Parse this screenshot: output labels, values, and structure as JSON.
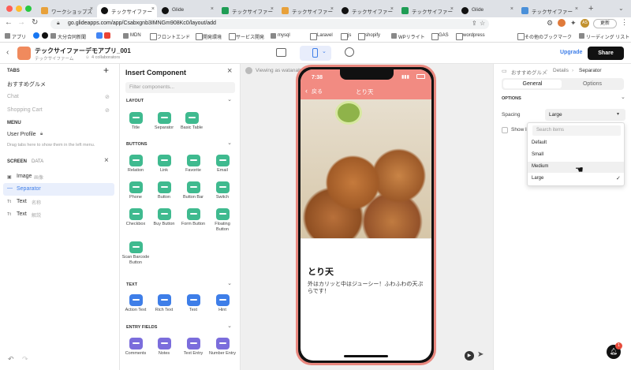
{
  "browser": {
    "tabs": [
      {
        "title": "ワークショップス"
      },
      {
        "title": "テックサイファー"
      },
      {
        "title": "Glide"
      },
      {
        "title": "テックサイファー"
      },
      {
        "title": "テックサイファー"
      },
      {
        "title": "テックサイファー"
      },
      {
        "title": "テックサイファー"
      },
      {
        "title": "Glide"
      },
      {
        "title": "テックサイファー"
      }
    ],
    "url": "go.glideapps.com/app/Csabxgnb3IMNGm908Kc0/layout/add",
    "profile_badge": "AS",
    "update_label": "更新",
    "bookmarks": [
      "アプリ",
      "大分合同新聞",
      "MDN",
      "フロントエンド",
      "開発環境",
      "サービス開発",
      "mysql",
      "Laravel",
      "js",
      "shopify",
      "WPリライト",
      "GAS",
      "wordpress",
      "その他のブックマーク",
      "リーディング リスト"
    ]
  },
  "header": {
    "app_name": "テックサイファーデモアプリ_001",
    "app_sub": "テックサイファーム",
    "collaborators": "4 collaborators",
    "upgrade": "Upgrade",
    "share": "Share"
  },
  "left": {
    "tabs_label": "TABS",
    "tabs": [
      "おすすめグルメ",
      "Chat",
      "Shopping Cart"
    ],
    "menu_label": "MENU",
    "menu_item": "User Profile",
    "hint": "Drag tabs here to show them in the left menu.",
    "screen_label": "SCREEN",
    "data_label": "DATA",
    "components": [
      {
        "name": "Image",
        "sub": "画像"
      },
      {
        "name": "Separator",
        "sub": ""
      },
      {
        "name": "Text",
        "sub": "名称"
      },
      {
        "name": "Text",
        "sub": "解説"
      }
    ]
  },
  "insert": {
    "title": "Insert Component",
    "placeholder": "Filter components...",
    "layout_label": "LAYOUT",
    "layout": [
      "Title",
      "Separator",
      "Basic Table"
    ],
    "buttons_label": "BUTTONS",
    "buttons": [
      "Relation",
      "Link",
      "Favorite",
      "Email",
      "Phone",
      "Button",
      "Button Bar",
      "Switch",
      "Checkbox",
      "Buy Button",
      "Form Button",
      "Floating Button",
      "Scan Barcode Button"
    ],
    "text_label": "TEXT",
    "text": [
      "Action Text",
      "Rich Text",
      "Text",
      "Hint"
    ],
    "entry_label": "ENTRY FIELDS",
    "entry": [
      "Comments",
      "Notes",
      "Text Entry",
      "Number Entry"
    ]
  },
  "canvas": {
    "viewing_as": "Viewing as watanab",
    "time": "7:38",
    "back": "戻る",
    "screen_title": "とり天",
    "item_title": "とり天",
    "item_desc": "外はカリッと中はジューシー！ふわふわの天ぷらです！"
  },
  "right": {
    "breadcrumb": [
      "おすすめグルメ",
      "Details",
      "Separator"
    ],
    "tab_general": "General",
    "tab_options": "Options",
    "options_label": "OPTIONS",
    "spacing_label": "Spacing",
    "spacing_value": "Large",
    "show_label": "Show li",
    "search_placeholder": "Search items",
    "options": [
      "Default",
      "Small",
      "Medium",
      "Large"
    ],
    "selected": "Large"
  },
  "colors": {
    "accent": "#e9887f",
    "brand_green": "#3fba8f",
    "blue": "#3e7ee8"
  },
  "notification_count": "1"
}
